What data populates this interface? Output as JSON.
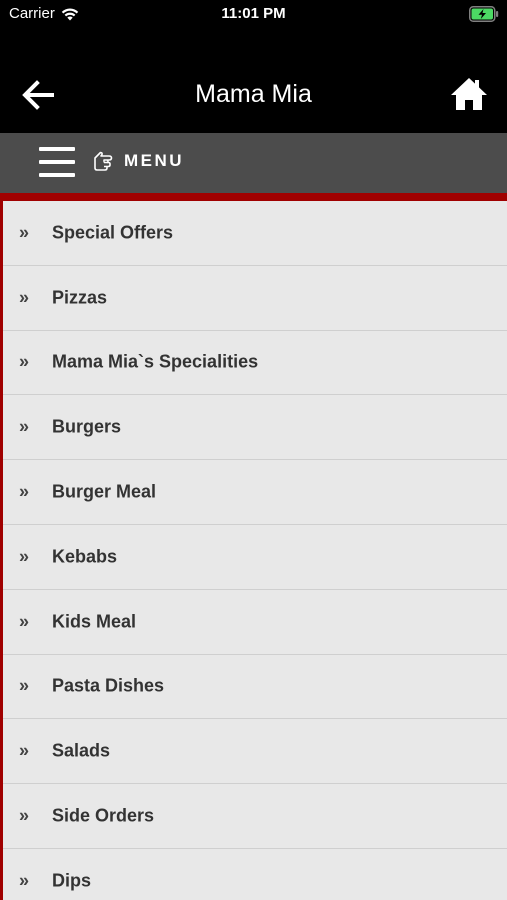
{
  "status_bar": {
    "carrier": "Carrier",
    "time": "11:01 PM",
    "wifi_icon": "wifi-icon",
    "battery_icon": "battery-charging-icon",
    "battery_color": "#4cd964"
  },
  "header": {
    "title": "Mama Mia",
    "back_icon": "arrow-left-icon",
    "home_icon": "home-icon"
  },
  "menu_bar": {
    "label": "MENU",
    "hamburger_icon": "hamburger-icon",
    "hand_icon": "pointing-hand-icon"
  },
  "colors": {
    "header_bg": "#000000",
    "menu_bar_bg": "#4c4c4c",
    "accent_red": "#a00000",
    "list_bg": "#e8e8e8"
  },
  "categories": [
    {
      "label": "Special Offers"
    },
    {
      "label": "Pizzas"
    },
    {
      "label": "Mama Mia`s Specialities"
    },
    {
      "label": "Burgers"
    },
    {
      "label": "Burger Meal"
    },
    {
      "label": "Kebabs"
    },
    {
      "label": "Kids Meal"
    },
    {
      "label": "Pasta Dishes"
    },
    {
      "label": "Salads"
    },
    {
      "label": "Side Orders"
    },
    {
      "label": "Dips"
    }
  ],
  "chevron": "»"
}
